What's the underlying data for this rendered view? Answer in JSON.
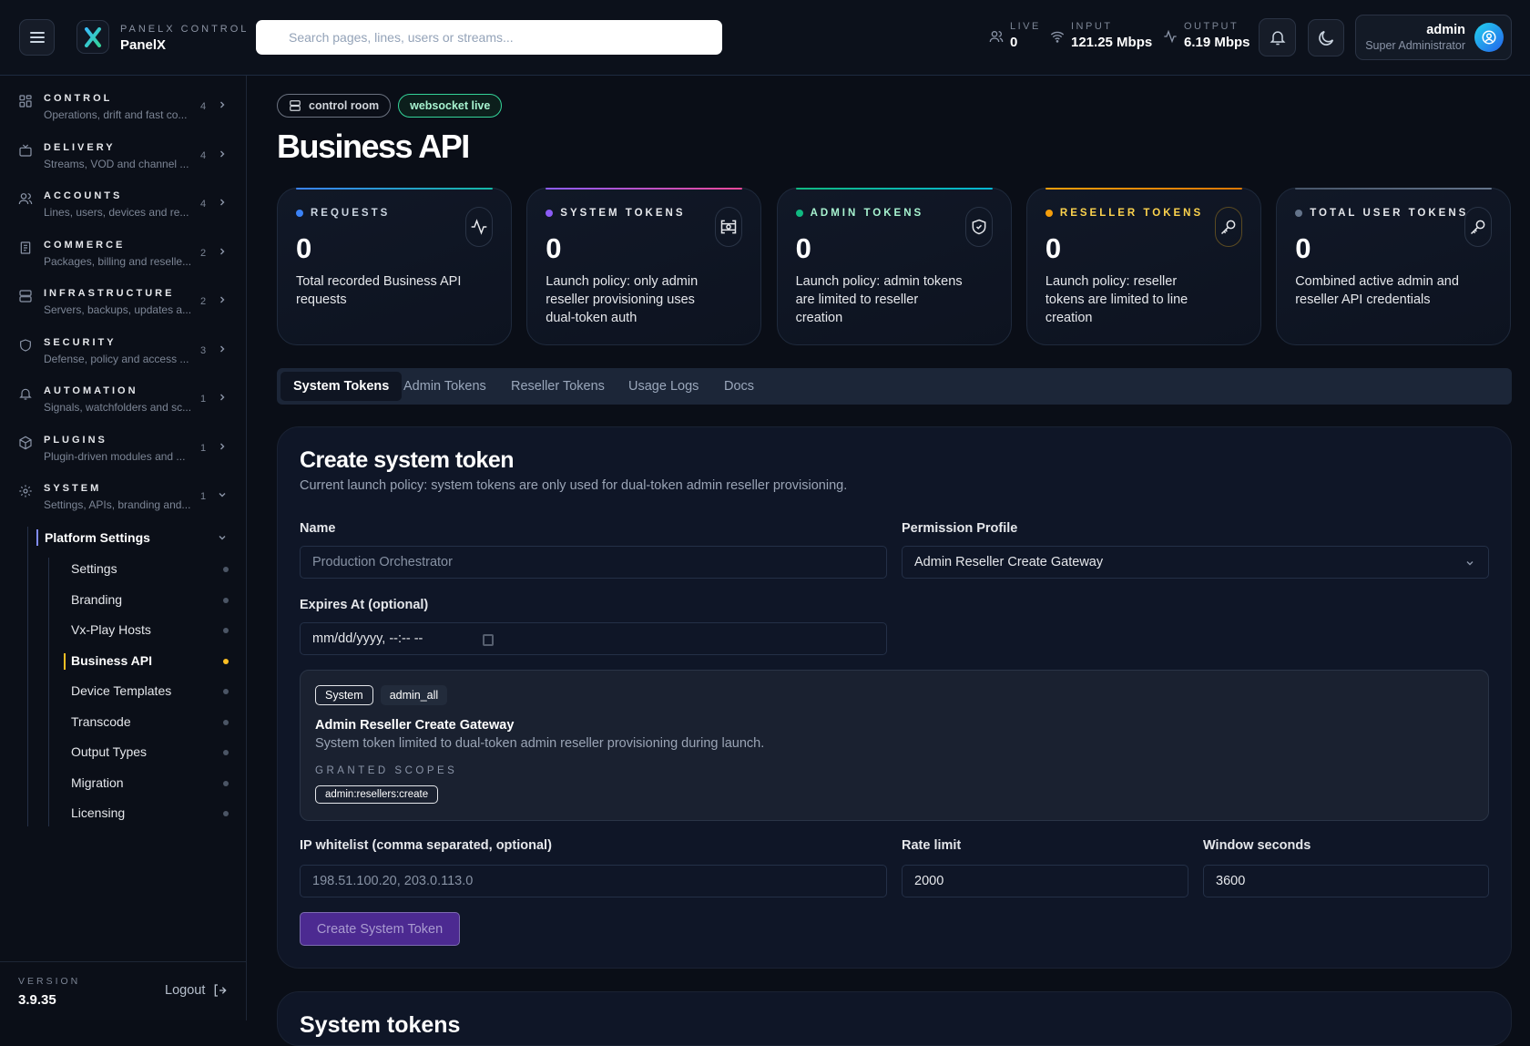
{
  "header": {
    "menu_icon": "hamburger-icon",
    "brand_kicker": "PANELX CONTROL",
    "brand_name": "PanelX",
    "search_placeholder": "Search pages, lines, users or streams...",
    "stats": [
      {
        "label": "LIVE",
        "value": "0",
        "icon": "users-icon"
      },
      {
        "label": "INPUT",
        "value": "121.25 Mbps",
        "icon": "wifi-icon"
      },
      {
        "label": "OUTPUT",
        "value": "6.19 Mbps",
        "icon": "activity-icon"
      }
    ],
    "user": {
      "name": "admin",
      "role": "Super Administrator"
    }
  },
  "sidebar": {
    "sections": [
      {
        "label": "CONTROL",
        "desc": "Operations, drift and fast co...",
        "count": "4",
        "icon": "grid-icon"
      },
      {
        "label": "DELIVERY",
        "desc": "Streams, VOD and channel ...",
        "count": "4",
        "icon": "tv-icon"
      },
      {
        "label": "ACCOUNTS",
        "desc": "Lines, users, devices and re...",
        "count": "4",
        "icon": "users-icon"
      },
      {
        "label": "COMMERCE",
        "desc": "Packages, billing and reselle...",
        "count": "2",
        "icon": "receipt-icon"
      },
      {
        "label": "INFRASTRUCTURE",
        "desc": "Servers, backups, updates a...",
        "count": "2",
        "icon": "server-icon"
      },
      {
        "label": "SECURITY",
        "desc": "Defense, policy and access ...",
        "count": "3",
        "icon": "shield-icon"
      },
      {
        "label": "AUTOMATION",
        "desc": "Signals, watchfolders and sc...",
        "count": "1",
        "icon": "bell-icon"
      },
      {
        "label": "PLUGINS",
        "desc": "Plugin-driven modules and ...",
        "count": "1",
        "icon": "package-icon"
      },
      {
        "label": "SYSTEM",
        "desc": "Settings, APIs, branding and...",
        "count": "1",
        "icon": "gear-icon"
      }
    ],
    "group": "Platform Settings",
    "items": [
      "Settings",
      "Branding",
      "Vx-Play Hosts",
      "Business API",
      "Device Templates",
      "Transcode",
      "Output Types",
      "Migration",
      "Licensing"
    ],
    "active_item": "Business API",
    "version_label": "VERSION",
    "version": "3.9.35",
    "logout": "Logout"
  },
  "page": {
    "pills": [
      "control room",
      "websocket live"
    ],
    "title": "Business API",
    "cards": [
      {
        "label": "REQUESTS",
        "value": "0",
        "desc": "Total recorded Business API requests",
        "color": "#3b82f6",
        "icon": "activity-icon"
      },
      {
        "label": "SYSTEM TOKENS",
        "value": "0",
        "desc": "Launch policy: only admin reseller provisioning uses dual-token auth",
        "color": "#8b5cf6",
        "icon": "system-token-icon"
      },
      {
        "label": "ADMIN TOKENS",
        "value": "0",
        "desc": "Launch policy: admin tokens are limited to reseller creation",
        "color": "#10b981",
        "icon": "shield-check-icon"
      },
      {
        "label": "RESELLER TOKENS",
        "value": "0",
        "desc": "Launch policy: reseller tokens are limited to line creation",
        "color": "#f59e0b",
        "icon": "key-icon"
      },
      {
        "label": "TOTAL USER TOKENS",
        "value": "0",
        "desc": "Combined active admin and reseller API credentials",
        "color": "#64748b",
        "icon": "key-icon"
      }
    ],
    "tabs": [
      "System Tokens",
      "Admin Tokens",
      "Reseller Tokens",
      "Usage Logs",
      "Docs"
    ],
    "form": {
      "title": "Create system token",
      "subtitle": "Current launch policy: system tokens are only used for dual-token admin reseller provisioning.",
      "name_label": "Name",
      "name_placeholder": "Production Orchestrator",
      "profile_label": "Permission Profile",
      "profile_value": "Admin Reseller Create Gateway",
      "expires_label": "Expires At (optional)",
      "expires_placeholder": "mm/dd/yyyy, --:-- --",
      "profile_box": {
        "badge": "System",
        "tag": "admin_all",
        "title": "Admin Reseller Create Gateway",
        "desc": "System token limited to dual-token admin reseller provisioning during launch.",
        "scopes_label": "GRANTED SCOPES",
        "scopes": [
          "admin:resellers:create"
        ]
      },
      "ip_label": "IP whitelist (comma separated, optional)",
      "ip_placeholder": "198.51.100.20, 203.0.113.0",
      "rate_label": "Rate limit",
      "rate_value": "2000",
      "window_label": "Window seconds",
      "window_value": "3600",
      "submit": "Create System Token"
    },
    "next_section_title": "System tokens"
  }
}
